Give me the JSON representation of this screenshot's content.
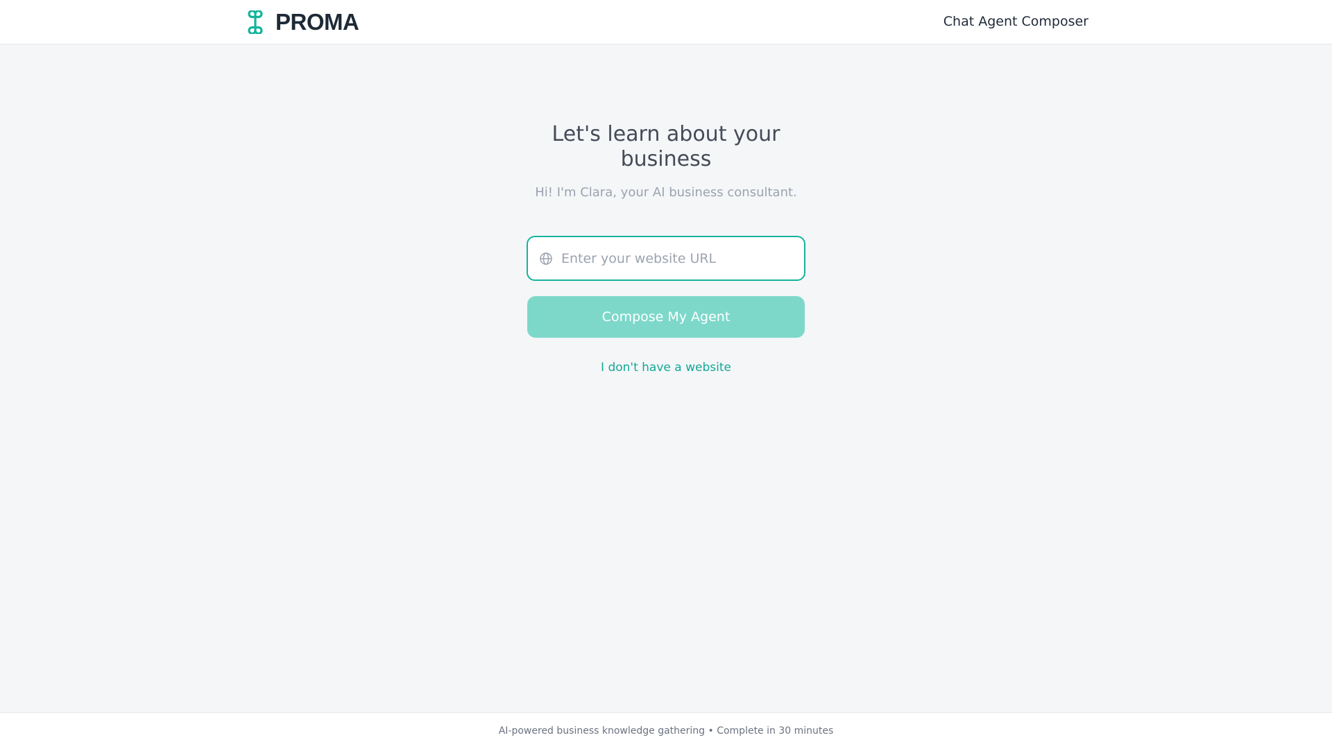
{
  "header": {
    "logo_text": "PROMA",
    "title": "Chat Agent Composer"
  },
  "main": {
    "heading": "Let's learn about your business",
    "subheading": "Hi! I'm Clara, your AI business consultant.",
    "url_input": {
      "value": "",
      "placeholder": "Enter your website URL",
      "icon": "globe-icon"
    },
    "compose_button": "Compose My Agent",
    "no_website_link": "I don't have a website"
  },
  "footer": {
    "text": "AI-powered business knowledge gathering • Complete in 30 minutes"
  },
  "colors": {
    "accent": "#14b39c",
    "button_disabled": "#7dd8ca",
    "background": "#f4f6f8",
    "logo_text": "#1e2a36"
  }
}
